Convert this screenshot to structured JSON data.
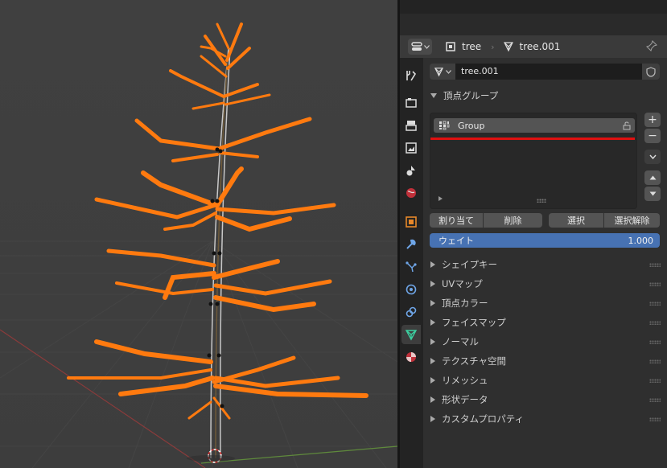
{
  "header": {
    "object_name": "tree",
    "mesh_name": "tree.001"
  },
  "datablock": {
    "name": "tree.001"
  },
  "vertex_groups": {
    "title": "頂点グループ",
    "items": [
      {
        "name": "Group"
      }
    ],
    "assign_label": "割り当て",
    "remove_label": "削除",
    "select_label": "選択",
    "deselect_label": "選択解除",
    "weight_label": "ウェイト",
    "weight_value": "1.000",
    "add_symbol": "+",
    "remove_symbol": "−"
  },
  "panels": [
    {
      "label": "シェイプキー"
    },
    {
      "label": "UVマップ"
    },
    {
      "label": "頂点カラー"
    },
    {
      "label": "フェイスマップ"
    },
    {
      "label": "ノーマル"
    },
    {
      "label": "テクスチャ空間"
    },
    {
      "label": "リメッシュ"
    },
    {
      "label": "形状データ"
    },
    {
      "label": "カスタムプロパティ"
    }
  ],
  "tabs": [
    {
      "icon": "tool-icon"
    },
    {
      "icon": "render-icon"
    },
    {
      "icon": "output-icon"
    },
    {
      "icon": "view-layer-icon"
    },
    {
      "icon": "scene-icon"
    },
    {
      "icon": "world-icon"
    },
    {
      "icon": "object-icon"
    },
    {
      "icon": "modifier-icon"
    },
    {
      "icon": "particles-icon"
    },
    {
      "icon": "physics-icon"
    },
    {
      "icon": "constraints-icon"
    },
    {
      "icon": "mesh-data-icon"
    },
    {
      "icon": "material-icon"
    }
  ],
  "colors": {
    "selected_orange": "#ff7a0f",
    "weight_blue": "#4772b3",
    "highlight_red": "#e01010",
    "active_tab_green": "#3ccfa0"
  }
}
